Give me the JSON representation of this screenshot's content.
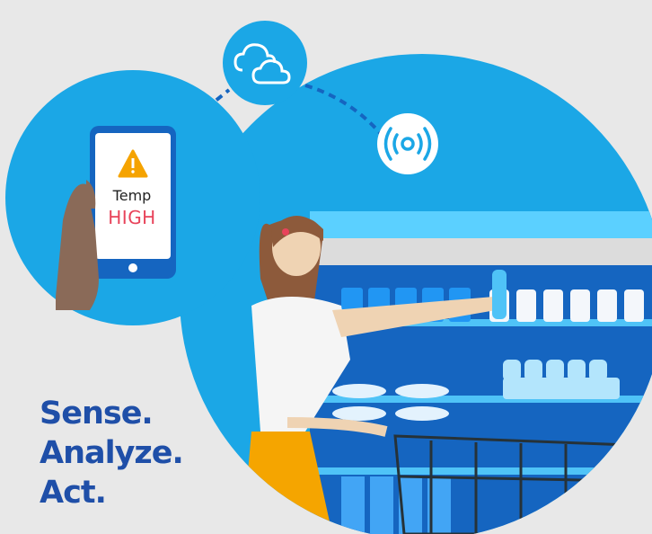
{
  "phone": {
    "alert_icon": "warning-triangle-icon",
    "line1": "Temp",
    "line2": "HIGH"
  },
  "icons": {
    "cloud": "cloud-icon",
    "sensor": "wireless-sensor-icon"
  },
  "tagline": {
    "line1": "Sense.",
    "line2": "Analyze.",
    "line3": "Act."
  },
  "colors": {
    "background": "#e8e8e8",
    "sky_blue": "#1ba7e6",
    "deep_blue": "#1565c0",
    "tagline": "#1f4fa8",
    "alert_red": "#e8435a",
    "alert_amber": "#f5a300",
    "skirt_yellow": "#f5a500"
  }
}
